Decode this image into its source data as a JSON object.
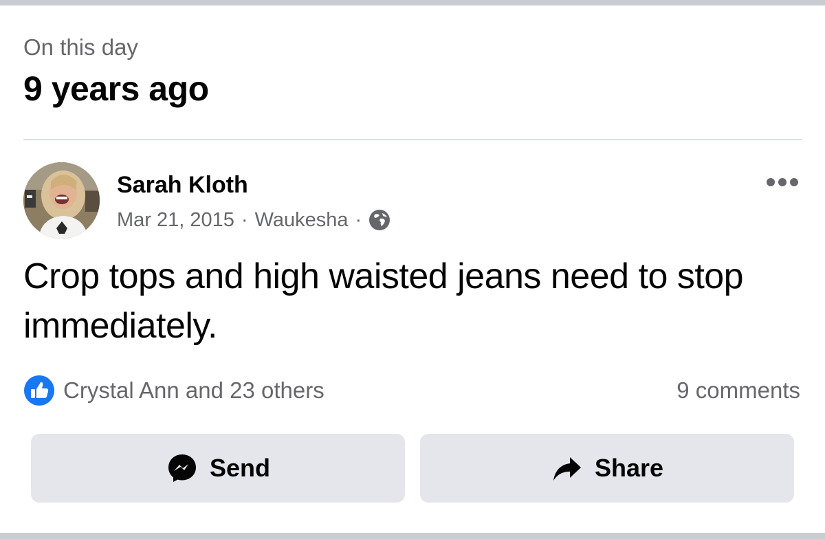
{
  "section": {
    "kicker": "On this day",
    "title": "9 years ago"
  },
  "post": {
    "author": "Sarah Kloth",
    "date": "Mar 21, 2015",
    "separator": "·",
    "location": "Waukesha",
    "audience_icon": "globe-icon",
    "more_icon": "more-options-icon",
    "text": "Crop tops and high waisted jeans need to stop immediately."
  },
  "engagement": {
    "reaction_icon": "like-icon",
    "reactions_text": "Crystal Ann and 23 others",
    "comments_text": "9 comments"
  },
  "actions": {
    "send_label": "Send",
    "send_icon": "messenger-icon",
    "share_label": "Share",
    "share_icon": "share-arrow-icon"
  },
  "colors": {
    "text_primary": "#050505",
    "text_secondary": "#65676b",
    "like_blue": "#1877f2",
    "button_bg": "#e4e6eb",
    "divider": "#dadde1"
  }
}
